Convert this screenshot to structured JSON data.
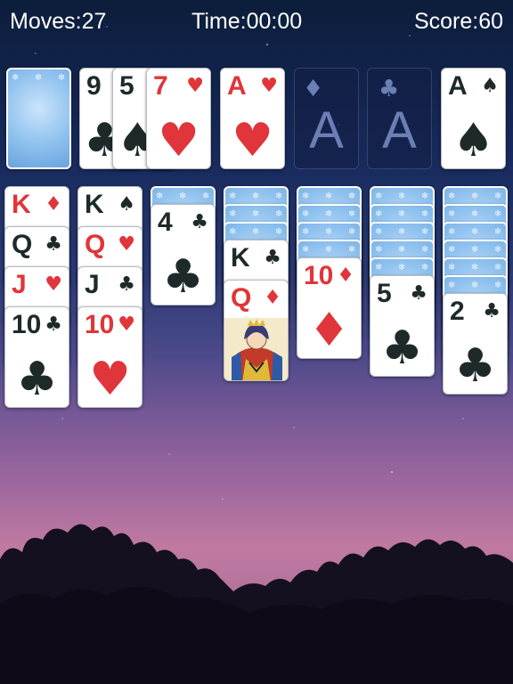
{
  "hud": {
    "moves": "Moves:27",
    "time": "Time:00:00",
    "score": "Score:60"
  },
  "colors": {
    "red": "#e0353a",
    "black": "#1e2a2a",
    "card_back": "#8ec1ee"
  },
  "stock": {
    "face_down": true
  },
  "waste": [
    {
      "rank": "9",
      "suit": "♣",
      "color": "black"
    },
    {
      "rank": "5",
      "suit": "♠",
      "color": "black"
    },
    {
      "rank": "7",
      "suit": "♥",
      "color": "red"
    }
  ],
  "foundations": [
    {
      "rank": "A",
      "suit": "♥",
      "color": "red",
      "empty": false
    },
    {
      "rank": "A",
      "suit": "♦",
      "color": "black",
      "empty": true
    },
    {
      "rank": "A",
      "suit": "♣",
      "color": "black",
      "empty": true
    },
    {
      "rank": "A",
      "suit": "♠",
      "color": "black",
      "empty": false
    }
  ],
  "tableau": [
    {
      "hidden": 0,
      "cards": [
        {
          "rank": "K",
          "suit": "♦",
          "color": "red"
        },
        {
          "rank": "Q",
          "suit": "♣",
          "color": "black"
        },
        {
          "rank": "J",
          "suit": "♥",
          "color": "red"
        },
        {
          "rank": "10",
          "suit": "♣",
          "color": "black"
        }
      ]
    },
    {
      "hidden": 0,
      "cards": [
        {
          "rank": "K",
          "suit": "♠",
          "color": "black"
        },
        {
          "rank": "Q",
          "suit": "♥",
          "color": "red"
        },
        {
          "rank": "J",
          "suit": "♣",
          "color": "black"
        },
        {
          "rank": "10",
          "suit": "♥",
          "color": "red"
        }
      ]
    },
    {
      "hidden": 1,
      "cards": [
        {
          "rank": "4",
          "suit": "♣",
          "color": "black"
        }
      ]
    },
    {
      "hidden": 3,
      "cards": [
        {
          "rank": "K",
          "suit": "♣",
          "color": "black"
        },
        {
          "rank": "Q",
          "suit": "♦",
          "color": "red"
        }
      ]
    },
    {
      "hidden": 4,
      "cards": [
        {
          "rank": "10",
          "suit": "♦",
          "color": "red"
        }
      ]
    },
    {
      "hidden": 5,
      "cards": [
        {
          "rank": "5",
          "suit": "♣",
          "color": "black"
        }
      ]
    },
    {
      "hidden": 6,
      "cards": [
        {
          "rank": "2",
          "suit": "♣",
          "color": "black"
        }
      ]
    }
  ]
}
